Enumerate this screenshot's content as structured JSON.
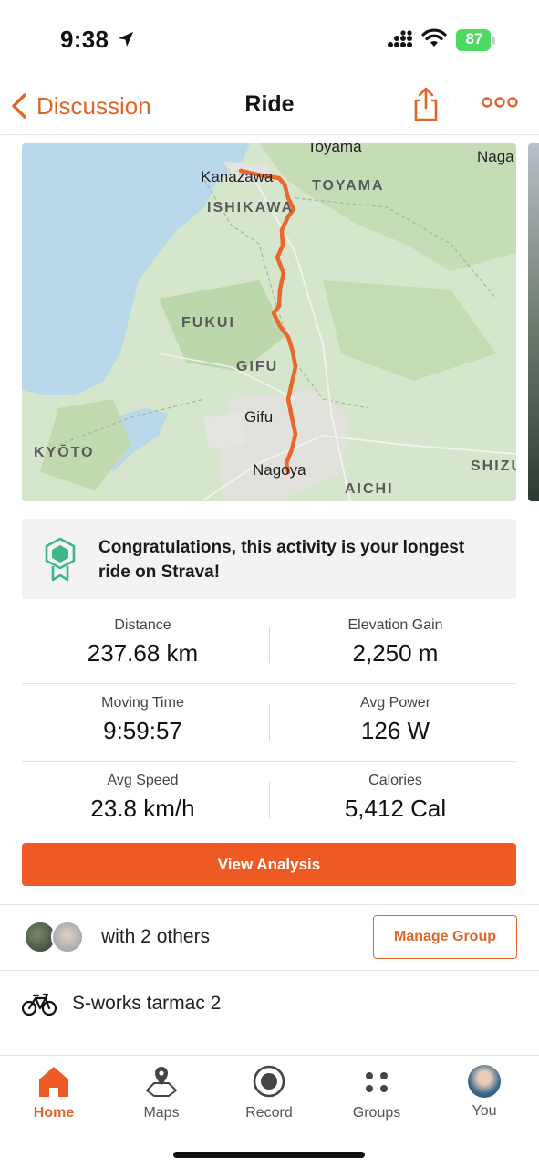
{
  "status_bar": {
    "time": "9:38",
    "battery": "87"
  },
  "nav": {
    "back_label": "Discussion",
    "title": "Ride"
  },
  "map": {
    "labels": {
      "toyama_city": "Toyama",
      "toyama_pref": "TOYAMA",
      "naga": "Naga",
      "kanazawa": "Kanazawa",
      "ishikawa": "ISHIKAWA",
      "fukui": "FUKUI",
      "gifu_pref": "GIFU",
      "gifu_city": "Gifu",
      "kyoto": "KYŌTO",
      "nagoya": "Nagoya",
      "aichi": "AICHI",
      "shizu": "SHIZU"
    },
    "route_color": "#e8672c"
  },
  "congrats": {
    "text": "Congratulations, this activity is your longest ride on Strava!"
  },
  "stats": [
    {
      "left": {
        "label": "Distance",
        "value": "237.68 km"
      },
      "right": {
        "label": "Elevation Gain",
        "value": "2,250 m"
      }
    },
    {
      "left": {
        "label": "Moving Time",
        "value": "9:59:57"
      },
      "right": {
        "label": "Avg Power",
        "value": "126 W"
      }
    },
    {
      "left": {
        "label": "Avg Speed",
        "value": "23.8 km/h"
      },
      "right": {
        "label": "Calories",
        "value": "5,412 Cal"
      }
    }
  ],
  "analysis_button": "View Analysis",
  "group": {
    "with_text": "with 2 others",
    "manage_button": "Manage Group"
  },
  "bike": {
    "name": "S-works tarmac 2"
  },
  "tabs": [
    {
      "label": "Home",
      "icon": "home-icon",
      "active": true
    },
    {
      "label": "Maps",
      "icon": "maps-icon"
    },
    {
      "label": "Record",
      "icon": "record-icon"
    },
    {
      "label": "Groups",
      "icon": "groups-icon"
    },
    {
      "label": "You",
      "icon": "profile-avatar"
    }
  ],
  "colors": {
    "accent": "#ef5a24",
    "accent_text": "#e0652a",
    "battery": "#4cd964"
  }
}
